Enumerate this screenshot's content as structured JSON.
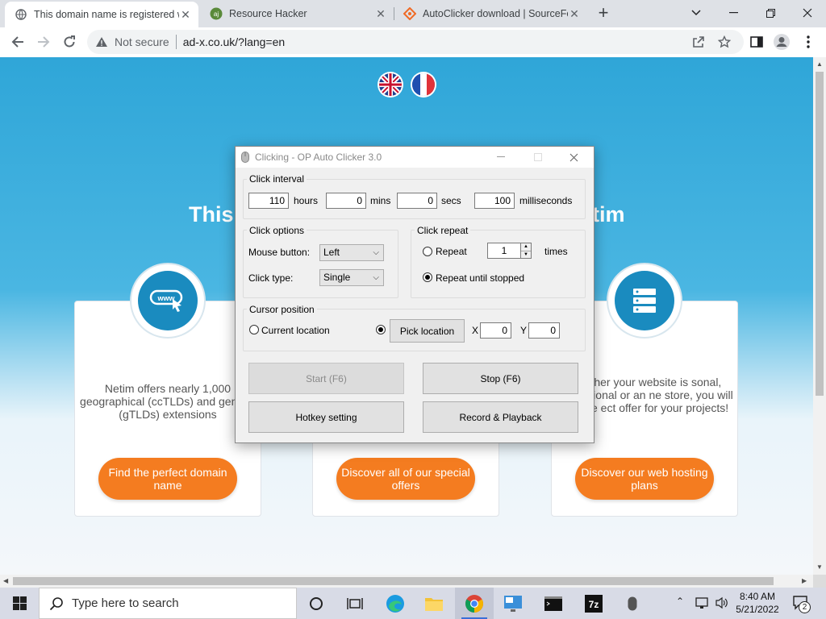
{
  "browser": {
    "tabs": [
      {
        "title": "This domain name is registered w",
        "active": true
      },
      {
        "title": "Resource Hacker",
        "active": false
      },
      {
        "title": "AutoClicker download | SourceFo",
        "active": false
      }
    ],
    "new_tab": "+",
    "security_label": "Not secure",
    "url": "ad-x.co.uk/?lang=en"
  },
  "page": {
    "heading_left": "This",
    "heading_right": "tim",
    "cards": [
      {
        "text": "Netim offers nearly 1,000 geographical (ccTLDs) and generic (gTLDs) extensions",
        "button": "Find the perfect domain name"
      },
      {
        "text": "",
        "button": "Discover all of our special offers"
      },
      {
        "text": "Whether your website is sonal, professional or an ne store, you will find the ect offer for your projects!",
        "button": "Discover our web hosting plans"
      }
    ],
    "icon_www": "www"
  },
  "dialog": {
    "title": "Clicking - OP Auto Clicker 3.0",
    "interval": {
      "label": "Click interval",
      "hours": "110",
      "hours_label": "hours",
      "mins": "0",
      "mins_label": "mins",
      "secs": "0",
      "secs_label": "secs",
      "ms": "100",
      "ms_label": "milliseconds"
    },
    "options": {
      "label": "Click options",
      "mouse_button_label": "Mouse button:",
      "mouse_button_value": "Left",
      "click_type_label": "Click type:",
      "click_type_value": "Single"
    },
    "repeat": {
      "label": "Click repeat",
      "repeat_label": "Repeat",
      "repeat_count": "1",
      "times_label": "times",
      "until_stopped_label": "Repeat until stopped"
    },
    "cursor": {
      "label": "Cursor position",
      "current_label": "Current location",
      "pick_button": "Pick location",
      "x_label": "X",
      "x_value": "0",
      "y_label": "Y",
      "y_value": "0"
    },
    "buttons": {
      "start": "Start (F6)",
      "stop": "Stop (F6)",
      "hotkey": "Hotkey setting",
      "record": "Record & Playback"
    }
  },
  "taskbar": {
    "search_placeholder": "Type here to search",
    "time": "8:40 AM",
    "date": "5/21/2022",
    "notification_count": "2"
  }
}
